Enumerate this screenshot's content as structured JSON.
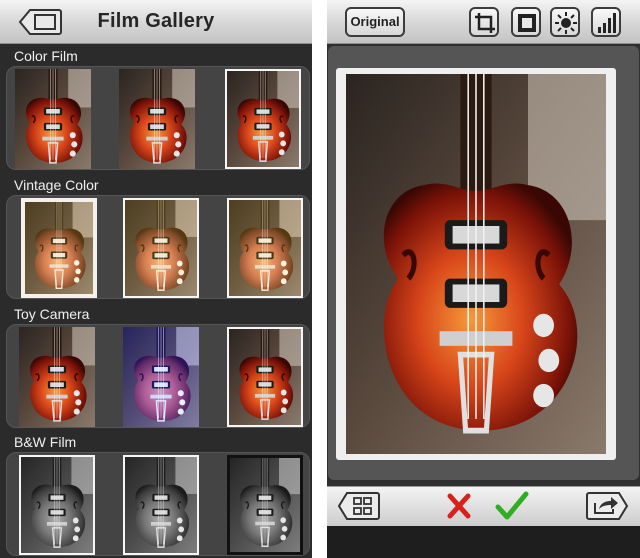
{
  "gallery": {
    "title": "Film Gallery",
    "categories": [
      {
        "label": "Color Film"
      },
      {
        "label": "Vintage Color"
      },
      {
        "label": "Toy Camera"
      },
      {
        "label": "B&W Film"
      }
    ]
  },
  "editor": {
    "original_label": "Original",
    "tools": [
      "crop-icon",
      "border-icon",
      "brightness-icon",
      "levels-icon"
    ],
    "bottom_actions": [
      "grid-icon",
      "cancel-x-icon",
      "confirm-check-icon",
      "share-icon"
    ]
  },
  "colors": {
    "accent_red": "#d8211c",
    "accent_green": "#2fae22",
    "guitar_orange": "#d2471c"
  }
}
